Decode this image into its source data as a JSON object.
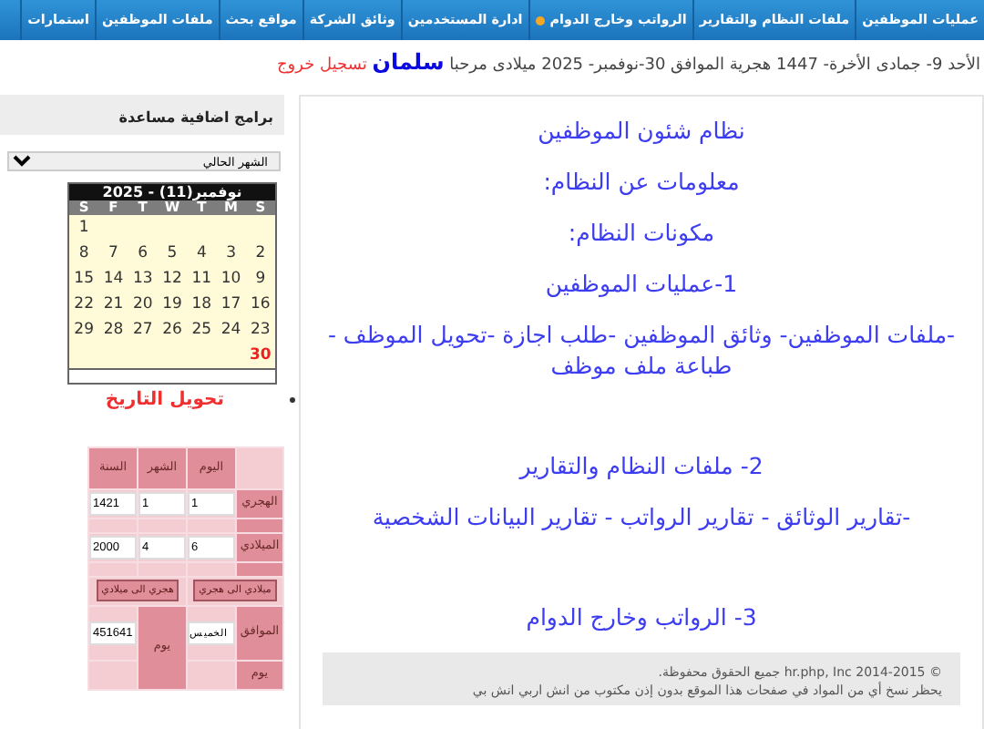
{
  "nav": {
    "items": [
      {
        "label": "عمليات الموظفين",
        "dot": false
      },
      {
        "label": "ملفات النظام والتقارير",
        "dot": false
      },
      {
        "label": "الرواتب وخارج الدوام",
        "dot": true
      },
      {
        "label": "ادارة المستخدمين",
        "dot": false
      },
      {
        "label": "وثائق الشركة",
        "dot": false
      },
      {
        "label": "مواقع بحث",
        "dot": false
      },
      {
        "label": "ملفات الموظفين",
        "dot": false
      },
      {
        "label": "استمارات",
        "dot": false
      }
    ]
  },
  "greeting": {
    "date_text": "الأحد 9- جمادى الأخرة- 1447 هجرية الموافق 30-نوفمبر- 2025 ميلادى مرحبا",
    "user": "سلمان",
    "logout": "تسجيل خروج"
  },
  "sidebar": {
    "title": "برامج اضافية مساعدة",
    "month_select": {
      "value": "الشهر الحالي"
    },
    "calendar": {
      "title": "نوفمبر(11) - 2025",
      "weekdays": [
        "S",
        "M",
        "T",
        "W",
        "T",
        "F",
        "S"
      ],
      "weeks": [
        [
          {
            "day": "1",
            "today": false
          }
        ],
        [
          {
            "day": "2",
            "today": false
          },
          {
            "day": "3",
            "today": false
          },
          {
            "day": "4",
            "today": false
          },
          {
            "day": "5",
            "today": false
          },
          {
            "day": "6",
            "today": false
          },
          {
            "day": "7",
            "today": false
          },
          {
            "day": "8",
            "today": false
          }
        ],
        [
          {
            "day": "9",
            "today": false
          },
          {
            "day": "10",
            "today": false
          },
          {
            "day": "11",
            "today": false
          },
          {
            "day": "12",
            "today": false
          },
          {
            "day": "13",
            "today": false
          },
          {
            "day": "14",
            "today": false
          },
          {
            "day": "15",
            "today": false
          }
        ],
        [
          {
            "day": "16",
            "today": false
          },
          {
            "day": "17",
            "today": false
          },
          {
            "day": "18",
            "today": false
          },
          {
            "day": "19",
            "today": false
          },
          {
            "day": "20",
            "today": false
          },
          {
            "day": "21",
            "today": false
          },
          {
            "day": "22",
            "today": false
          }
        ],
        [
          {
            "day": "23",
            "today": false
          },
          {
            "day": "24",
            "today": false
          },
          {
            "day": "25",
            "today": false
          },
          {
            "day": "26",
            "today": false
          },
          {
            "day": "27",
            "today": false
          },
          {
            "day": "28",
            "today": false
          },
          {
            "day": "29",
            "today": false
          }
        ],
        [
          {
            "day": "30",
            "today": true
          }
        ]
      ]
    },
    "converter": {
      "title": "تحويل التاريخ",
      "columns": [
        "اليوم",
        "الشهر",
        "السنة"
      ],
      "rows": [
        {
          "label": "الهجري",
          "values": [
            "1",
            "1",
            "1421"
          ]
        },
        {
          "label": "الميلادي",
          "values": [
            "6",
            "4",
            "2000"
          ]
        }
      ],
      "buttons": [
        "ميلادي الى هجري",
        "هجري الى ميلادي"
      ],
      "result": {
        "label": "الموافق",
        "day_name": "الخميس",
        "unit": "يوم",
        "value": "451641",
        "label_2": "يوم"
      }
    }
  },
  "content": {
    "sections": [
      {
        "lines": [
          "نظام شئون الموظفين",
          "معلومات عن النظام:",
          "مكونات النظام:",
          "1-عمليات الموظفين",
          "-ملفات الموظفين- وثائق الموظفين -طلب اجازة -تحويل الموظف - طباعة ملف موظف"
        ]
      },
      {
        "lines": [
          "2- ملفات النظام والتقارير",
          "-تقارير الوثائق - تقارير الرواتب - تقارير البيانات الشخصية"
        ]
      },
      {
        "lines": [
          "3- الرواتب وخارج الدوام"
        ]
      }
    ]
  },
  "footer": {
    "copyright": "© 2014-2015 hr.php, Inc جميع الحقوق محفوظة.",
    "notice": "يحظر نسخ أي من المواد في صفحات هذا الموقع بدون إذن مكتوب من انش اربي انش بي"
  }
}
